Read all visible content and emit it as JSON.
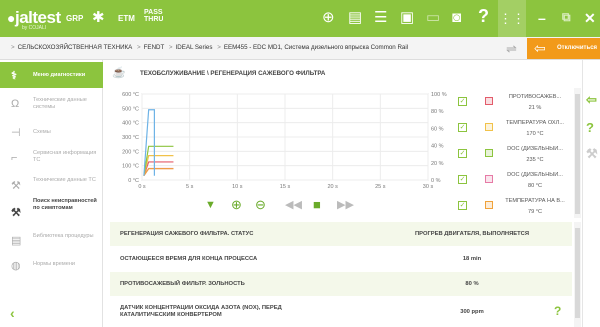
{
  "topbar": {
    "brand": "jaltest",
    "brand_sub": "by COJALI",
    "grp": "GRP",
    "etm": "ETM",
    "pass_thru_1": "PASS",
    "pass_thru_2": "THRU",
    "icons": [
      "mechanic-icon",
      "globe-icon",
      "document-icon",
      "list-icon",
      "briefcase-icon",
      "battery-icon",
      "camera-icon",
      "help-icon",
      "grid-icon"
    ],
    "win_min": "–",
    "win_restore": "⧉",
    "win_close": "✕"
  },
  "breadcrumb": {
    "items": [
      "СЕЛЬСКОХОЗЯЙСТВЕННАЯ ТЕХНИКА",
      "FENDT",
      "IDEAL Series",
      "EEM455 - EDC MD1, Система дизельного впрыска Common Rail"
    ],
    "disconnect_label": "Отключиться"
  },
  "sidebar": {
    "items": [
      {
        "label": "Меню диагностики",
        "icon": "stethoscope-icon"
      },
      {
        "label": "Технические данные системы",
        "icon": "technical-data-icon"
      },
      {
        "label": "Схемы",
        "icon": "schemes-icon"
      },
      {
        "label": "Сервисная информация ТС",
        "icon": "service-info-icon"
      },
      {
        "label": "Технические данные ТС",
        "icon": "vehicle-data-icon"
      },
      {
        "label": "Поиск неисправностей по симптомам",
        "icon": "troubleshooting-icon"
      },
      {
        "label": "Библиотека процедуры",
        "icon": "library-icon"
      },
      {
        "label": "Нормы времени",
        "icon": "time-icon"
      }
    ]
  },
  "main": {
    "title": "ТЕХОБСЛУЖИВАНИЕ \\ РЕГЕНЕРАЦИЯ САЖЕВОГО ФИЛЬТРА"
  },
  "chart_data": {
    "type": "line",
    "x_ticks": [
      "0 s",
      "5 s",
      "10 s",
      "15 s",
      "20 s",
      "25 s",
      "30 s"
    ],
    "y_left_ticks": [
      "0 °C",
      "100 °C",
      "200 °C",
      "300 °C",
      "400 °C",
      "500 °C",
      "600 °C"
    ],
    "y_right_ticks": [
      "0 %",
      "20 %",
      "40 %",
      "60 %",
      "80 %",
      "100 %"
    ],
    "xlim": [
      0,
      30
    ],
    "ylim_left": [
      0,
      600
    ],
    "ylim_right": [
      0,
      100
    ],
    "grid": true,
    "series": [
      {
        "name": "ПРОТИВОСАЖЕВ...",
        "color": "#e35b6a",
        "axis": "right",
        "x": [
          0.2,
          0.7,
          1.3,
          1.5,
          3.3
        ],
        "y": [
          5,
          21,
          21,
          21,
          21
        ]
      },
      {
        "name": "ТЕМПЕРАТУРА ОХЛ...",
        "color": "#f1c24a",
        "axis": "left",
        "x": [
          0.2,
          0.7,
          1.3,
          3.3
        ],
        "y": [
          30,
          170,
          170,
          170
        ]
      },
      {
        "name": "DOC (ДИЗЕЛЬНЫЙ...",
        "color": "#8cc43e",
        "axis": "left",
        "x": [
          0.2,
          0.7,
          1.3,
          3.3
        ],
        "y": [
          30,
          235,
          235,
          235
        ]
      },
      {
        "name": "DOC (ДИЗЕЛЬНЫЙ...",
        "color": "#e67ba6",
        "axis": "left",
        "x": [
          0.2,
          0.7,
          1.3,
          3.3
        ],
        "y": [
          30,
          80,
          80,
          80
        ]
      },
      {
        "name": "ТЕМПЕРАТУРА НА В...",
        "color": "#f0a23a",
        "axis": "left",
        "x": [
          0.2,
          0.7,
          1.3,
          3.3
        ],
        "y": [
          30,
          79,
          79,
          79
        ]
      },
      {
        "name": "",
        "color": "#6eb3e6",
        "axis": "left",
        "x": [
          0.2,
          0.7,
          1.3,
          1.3
        ],
        "y": [
          30,
          490,
          490,
          30
        ]
      }
    ]
  },
  "legend": [
    {
      "name": "ПРОТИВОСАЖЕВ...",
      "value": "21 %",
      "color": "#e35b6a"
    },
    {
      "name": "ТЕМПЕРАТУРА ОХЛ...",
      "value": "170 °C",
      "color": "#f1c24a"
    },
    {
      "name": "DOC (ДИЗЕЛЬНЫЙ...",
      "value": "235 °C",
      "color": "#8cc43e"
    },
    {
      "name": "DOC (ДИЗЕЛЬНЫЙ...",
      "value": "80 °C",
      "color": "#e67ba6"
    },
    {
      "name": "ТЕМПЕРАТУРА НА В...",
      "value": "79 °C",
      "color": "#f0a23a"
    }
  ],
  "table": [
    {
      "label": "РЕГЕНЕРАЦИЯ САЖЕВОГО ФИЛЬТРА. СТАТУС",
      "value": "ПРОГРЕВ ДВИГАТЕЛЯ, ВЫПОЛНЯЕТСЯ"
    },
    {
      "label": "ОСТАЮЩЕЕСЯ ВРЕМЯ ДЛЯ КОНЦА ПРОЦЕССА",
      "value": "18 min"
    },
    {
      "label": "ПРОТИВОСАЖЕВЫЙ ФИЛЬТР. ЗОЛЬНОСТЬ",
      "value": "80 %"
    },
    {
      "label": "ДАТЧИК КОНЦЕНТРАЦИИ ОКСИДА АЗОТА (NOX), ПЕРЕД КАТАЛИТИЧЕСКИМ КОНВЕРТЕРОМ",
      "value": "300 ppm"
    }
  ]
}
